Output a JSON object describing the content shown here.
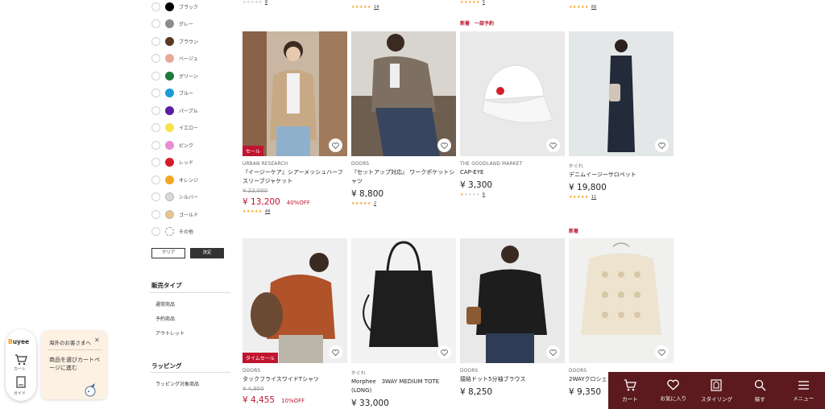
{
  "color_filter": {
    "options": [
      {
        "label": "ブラック",
        "color": "#000000"
      },
      {
        "label": "グレー",
        "color": "#8c8c8c"
      },
      {
        "label": "ブラウン",
        "color": "#5a3a24"
      },
      {
        "label": "ベージュ",
        "color": "#e8a99a"
      },
      {
        "label": "グリーン",
        "color": "#1f7a3a"
      },
      {
        "label": "ブルー",
        "color": "#1a9ad6"
      },
      {
        "label": "パープル",
        "color": "#5a1fa0"
      },
      {
        "label": "イエロー",
        "color": "#f7e24a"
      },
      {
        "label": "ピンク",
        "color": "#e88fd0"
      },
      {
        "label": "レッド",
        "color": "#d51b2a"
      },
      {
        "label": "オレンジ",
        "color": "#f5a623"
      },
      {
        "label": "シルバー",
        "color": "#d9d9d9"
      },
      {
        "label": "ゴールド",
        "color": "#e8c58a"
      },
      {
        "label": "その他",
        "color": "#ffffff"
      }
    ],
    "clear_label": "クリア",
    "apply_label": "決定"
  },
  "sales_type": {
    "title": "販売タイプ",
    "items": [
      "通常商品",
      "予約商品",
      "アウトレット"
    ]
  },
  "wrapping": {
    "title": "ラッピング",
    "items": [
      "ラッピング対象商品"
    ]
  },
  "top_partial_ratings": [
    {
      "count": "8",
      "filled": 0
    },
    {
      "count": "14",
      "filled": 5
    },
    {
      "count": "5",
      "filled": 5
    },
    {
      "count": "66",
      "filled": 5
    }
  ],
  "products_row1": [
    {
      "badge_above": "",
      "sale_tag": "セール",
      "brand": "URBAN RESEARCH",
      "name": "『イージーケア』シアーメッシュハーフスリーブジャケット",
      "original_price": "¥ 22,000",
      "price": "¥ 13,200",
      "off": "40%OFF",
      "is_sale": true,
      "rating_filled": 5,
      "rating_count": "49"
    },
    {
      "badge_above": "",
      "sale_tag": "",
      "brand": "DOORS",
      "name": "『セットアップ対応』 ワークポケットシャツ",
      "original_price": "",
      "price": "¥ 8,800",
      "off": "",
      "is_sale": false,
      "rating_filled": 5,
      "rating_count": "2"
    },
    {
      "badge_above": "新着　一部予約",
      "sale_tag": "",
      "brand": "THE GOODLAND MARKET",
      "name": "CAP-EYE",
      "original_price": "",
      "price": "¥ 3,300",
      "off": "",
      "is_sale": false,
      "rating_filled": 1,
      "rating_count": "6"
    },
    {
      "badge_above": "",
      "sale_tag": "",
      "brand": "かぐれ",
      "name": "デニムイージーサロペット",
      "original_price": "",
      "price": "¥ 19,800",
      "off": "",
      "is_sale": false,
      "rating_filled": 5,
      "rating_count": "11"
    }
  ],
  "products_row2": [
    {
      "badge_above": "",
      "sale_tag": "タイムセール",
      "brand": "DOORS",
      "name": "タックフライスワイドTシャツ",
      "original_price": "¥ 4,950",
      "price": "¥ 4,455",
      "off": "10%OFF",
      "is_sale": true
    },
    {
      "badge_above": "",
      "sale_tag": "",
      "brand": "かぐれ",
      "name": "Morphee　3WAY MEDIUM TOTE (LONG)",
      "original_price": "",
      "price": "¥ 33,000",
      "off": "",
      "is_sale": false
    },
    {
      "badge_above": "",
      "sale_tag": "",
      "brand": "DOORS",
      "name": "接結ドット5分袖ブラウス",
      "original_price": "",
      "price": "¥ 8,250",
      "off": "",
      "is_sale": false
    },
    {
      "badge_above": "新着",
      "sale_tag": "",
      "brand": "DOORS",
      "name": "2WAYクロシェ",
      "original_price": "",
      "price": "¥ 9,350",
      "off": "",
      "is_sale": false
    }
  ],
  "buyee": {
    "logo_prefix": "B",
    "logo_text": "uyee",
    "cart_label": "カート",
    "guide_label": "ガイド",
    "bubble_title": "海外のお客さまへ",
    "bubble_message": "商品を選びカートページに進む"
  },
  "bottom_nav": [
    {
      "label": "カート",
      "icon": "cart-icon"
    },
    {
      "label": "お気に入り",
      "icon": "heart-icon"
    },
    {
      "label": "スタイリング",
      "icon": "styling-icon"
    },
    {
      "label": "探す",
      "icon": "search-icon"
    },
    {
      "label": "メニュー",
      "icon": "menu-icon"
    }
  ]
}
